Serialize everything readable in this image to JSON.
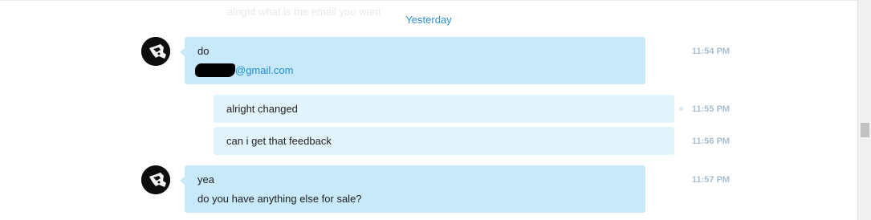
{
  "faded_message": "alright what is the email you want",
  "date_separator": "Yesterday",
  "messages": [
    {
      "sender": "incoming",
      "lines": [
        "do"
      ],
      "email_domain": "@gmail.com",
      "time": "11:54 PM"
    },
    {
      "sender": "outgoing",
      "lines": [
        "alright changed"
      ],
      "time": "11:55 PM"
    },
    {
      "sender": "outgoing",
      "lines": [
        "can i get that feedback"
      ],
      "time": "11:56 PM"
    },
    {
      "sender": "incoming",
      "lines": [
        "yea",
        "do you have anything else for sale?"
      ],
      "time": "11:57 PM"
    }
  ],
  "icons": {
    "avatar": "avatar-icon"
  },
  "colors": {
    "incoming_bubble": "#c7e9fa",
    "outgoing_bubble": "#e1f4fc",
    "date_separator": "#2b8fd6",
    "link": "#1d8ed6",
    "timestamp": "#a7bfd1"
  }
}
